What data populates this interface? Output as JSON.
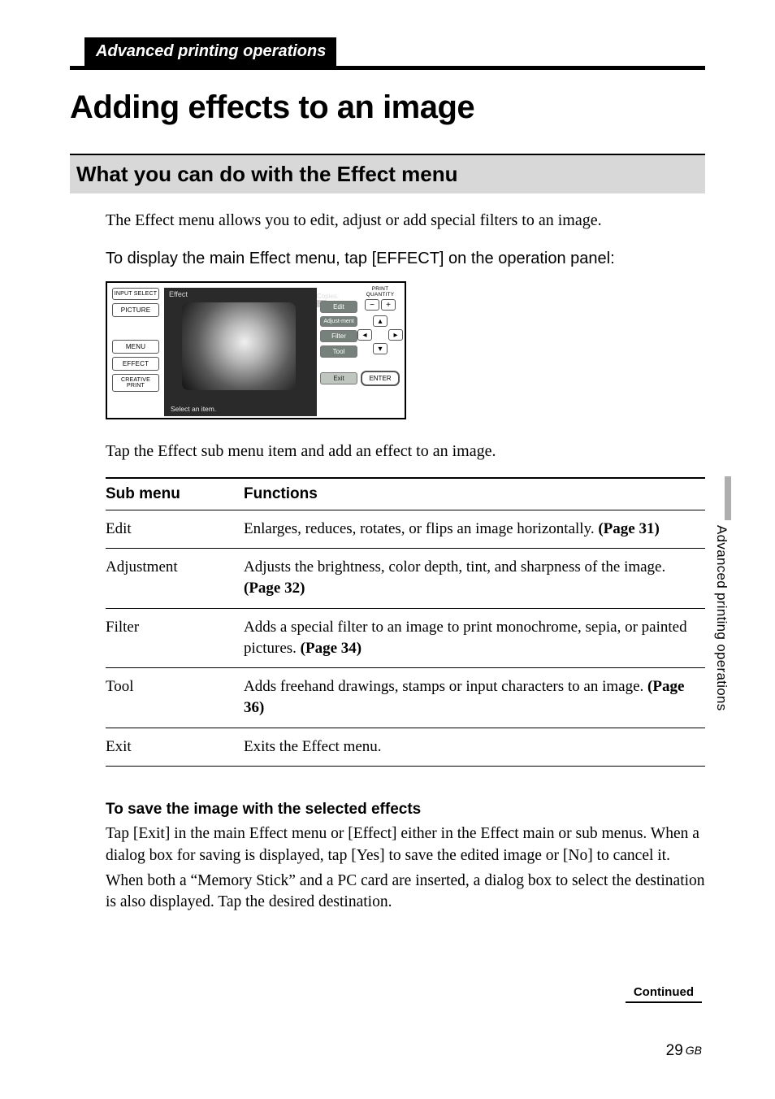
{
  "header": {
    "section": "Advanced printing operations"
  },
  "title": "Adding effects to an image",
  "section_heading": "What you can do with the Effect menu",
  "intro": "The Effect menu allows you to edit, adjust or add special filters to an image.",
  "display_instruction": "To display the main Effect menu, tap [EFFECT] on the operation panel:",
  "screenshot": {
    "left_buttons": [
      "INPUT SELECT",
      "PICTURE",
      "MENU",
      "EFFECT",
      "CREATIVE PRINT"
    ],
    "center_title": "Effect",
    "copies_label": "Copies:",
    "copies_value": "1",
    "right_buttons": [
      "Edit",
      "Adjust-ment",
      "Filter",
      "Tool",
      "Exit"
    ],
    "bottom_hint": "Select an item.",
    "pq_label": "PRINT QUANTITY",
    "minus": "−",
    "plus": "+",
    "enter": "ENTER"
  },
  "tap_line": "Tap the Effect sub menu item and add an effect to an image.",
  "table": {
    "head_sub": "Sub menu",
    "head_func": "Functions",
    "rows": [
      {
        "sub": "Edit",
        "func": "Enlarges, reduces, rotates, or flips an image horizontally. ",
        "bold": "(Page 31)"
      },
      {
        "sub": "Adjustment",
        "func": "Adjusts the brightness, color depth, tint, and sharpness of the image. ",
        "bold": "(Page 32)"
      },
      {
        "sub": "Filter",
        "func": "Adds a special filter to an image to print monochrome, sepia, or painted pictures. ",
        "bold": "(Page 34)"
      },
      {
        "sub": "Tool",
        "func": "Adds freehand drawings, stamps or input characters to an image. ",
        "bold": "(Page 36)"
      },
      {
        "sub": "Exit",
        "func": "Exits the Effect menu.",
        "bold": ""
      }
    ]
  },
  "save": {
    "heading": "To save the image with the selected effects",
    "para1": "Tap [Exit] in the main Effect menu or [Effect] either in the Effect main or sub menus.  When a dialog box for saving is displayed, tap [Yes] to save the edited image or [No] to cancel it.",
    "para2": "When both a “Memory Stick” and a PC card are inserted, a dialog box to select the destination is also displayed.  Tap the desired destination."
  },
  "side_tab": "Advanced printing operations",
  "continued": "Continued",
  "page_number": "29",
  "page_region": "GB"
}
